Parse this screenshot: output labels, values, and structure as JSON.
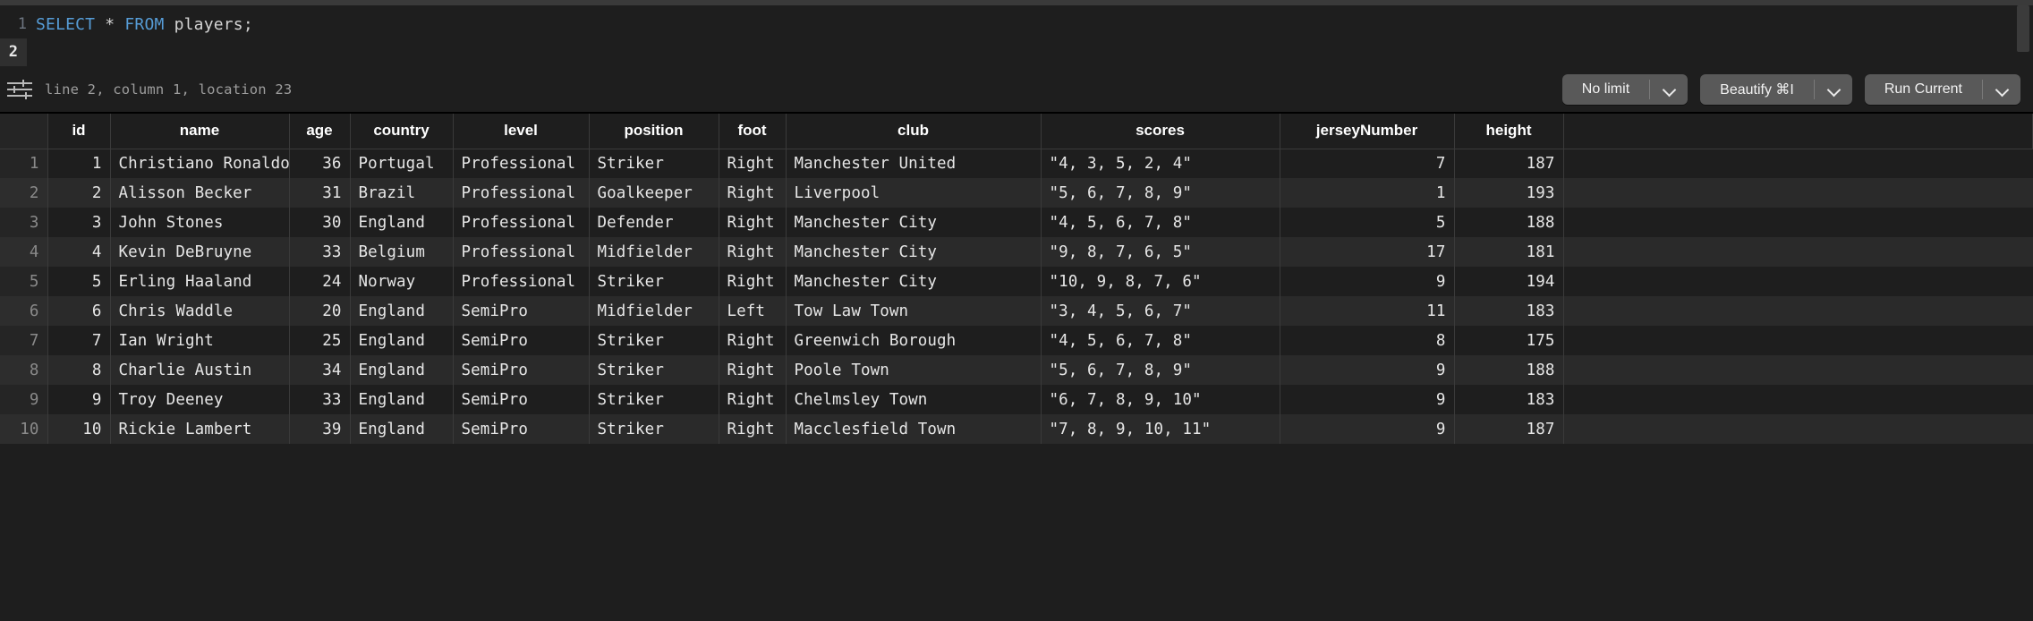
{
  "editor": {
    "line_numbers": [
      "1",
      "2"
    ],
    "active_line": "2",
    "code_tokens": [
      {
        "t": "SELECT",
        "k": "kw"
      },
      {
        "t": " ",
        "k": "op"
      },
      {
        "t": "*",
        "k": "op"
      },
      {
        "t": " ",
        "k": "op"
      },
      {
        "t": "FROM",
        "k": "kw"
      },
      {
        "t": " ",
        "k": "op"
      },
      {
        "t": "players;",
        "k": "id"
      }
    ],
    "code_text": "SELECT * FROM players;"
  },
  "statusbar": {
    "icon": "sliders-icon",
    "position_text": "line 2, column 1, location 23",
    "buttons": [
      {
        "label": "No limit",
        "icon": "chevron-down-icon"
      },
      {
        "label": "Beautify ⌘I",
        "icon": "chevron-down-icon"
      },
      {
        "label": "Run Current",
        "icon": "chevron-down-icon"
      }
    ]
  },
  "results": {
    "rownum_header": "",
    "columns": [
      {
        "key": "id",
        "label": "id",
        "align": "num"
      },
      {
        "key": "name",
        "label": "name",
        "align": "txt"
      },
      {
        "key": "age",
        "label": "age",
        "align": "num"
      },
      {
        "key": "country",
        "label": "country",
        "align": "txt"
      },
      {
        "key": "level",
        "label": "level",
        "align": "txt"
      },
      {
        "key": "position",
        "label": "position",
        "align": "txt"
      },
      {
        "key": "foot",
        "label": "foot",
        "align": "txt"
      },
      {
        "key": "club",
        "label": "club",
        "align": "txt"
      },
      {
        "key": "scores",
        "label": "scores",
        "align": "txt"
      },
      {
        "key": "jerseyNumber",
        "label": "jerseyNumber",
        "align": "num"
      },
      {
        "key": "height",
        "label": "height",
        "align": "num"
      }
    ],
    "rows": [
      {
        "n": "1",
        "id": "1",
        "name": "Christiano Ronaldo",
        "age": "36",
        "country": "Portugal",
        "level": "Professional",
        "position": "Striker",
        "foot": "Right",
        "club": "Manchester United",
        "scores": "\"4, 3, 5, 2, 4\"",
        "jerseyNumber": "7",
        "height": "187"
      },
      {
        "n": "2",
        "id": "2",
        "name": "Alisson Becker",
        "age": "31",
        "country": "Brazil",
        "level": "Professional",
        "position": "Goalkeeper",
        "foot": "Right",
        "club": "Liverpool",
        "scores": "\"5, 6, 7, 8, 9\"",
        "jerseyNumber": "1",
        "height": "193"
      },
      {
        "n": "3",
        "id": "3",
        "name": "John Stones",
        "age": "30",
        "country": "England",
        "level": "Professional",
        "position": "Defender",
        "foot": "Right",
        "club": "Manchester City",
        "scores": "\"4, 5, 6, 7, 8\"",
        "jerseyNumber": "5",
        "height": "188"
      },
      {
        "n": "4",
        "id": "4",
        "name": "Kevin DeBruyne",
        "age": "33",
        "country": "Belgium",
        "level": "Professional",
        "position": "Midfielder",
        "foot": "Right",
        "club": "Manchester City",
        "scores": "\"9, 8, 7, 6, 5\"",
        "jerseyNumber": "17",
        "height": "181"
      },
      {
        "n": "5",
        "id": "5",
        "name": "Erling Haaland",
        "age": "24",
        "country": "Norway",
        "level": "Professional",
        "position": "Striker",
        "foot": "Right",
        "club": "Manchester City",
        "scores": "\"10, 9, 8, 7, 6\"",
        "jerseyNumber": "9",
        "height": "194"
      },
      {
        "n": "6",
        "id": "6",
        "name": "Chris Waddle",
        "age": "20",
        "country": "England",
        "level": "SemiPro",
        "position": "Midfielder",
        "foot": "Left",
        "club": "Tow Law Town",
        "scores": "\"3, 4, 5, 6, 7\"",
        "jerseyNumber": "11",
        "height": "183"
      },
      {
        "n": "7",
        "id": "7",
        "name": "Ian Wright",
        "age": "25",
        "country": "England",
        "level": "SemiPro",
        "position": "Striker",
        "foot": "Right",
        "club": "Greenwich Borough",
        "scores": "\"4, 5, 6, 7, 8\"",
        "jerseyNumber": "8",
        "height": "175"
      },
      {
        "n": "8",
        "id": "8",
        "name": "Charlie Austin",
        "age": "34",
        "country": "England",
        "level": "SemiPro",
        "position": "Striker",
        "foot": "Right",
        "club": "Poole Town",
        "scores": "\"5, 6, 7, 8, 9\"",
        "jerseyNumber": "9",
        "height": "188"
      },
      {
        "n": "9",
        "id": "9",
        "name": "Troy Deeney",
        "age": "33",
        "country": "England",
        "level": "SemiPro",
        "position": "Striker",
        "foot": "Right",
        "club": "Chelmsley Town",
        "scores": "\"6, 7, 8, 9, 10\"",
        "jerseyNumber": "9",
        "height": "183"
      },
      {
        "n": "10",
        "id": "10",
        "name": "Rickie Lambert",
        "age": "39",
        "country": "England",
        "level": "SemiPro",
        "position": "Striker",
        "foot": "Right",
        "club": "Macclesfield Town",
        "scores": "\"7, 8, 9, 10, 11\"",
        "jerseyNumber": "9",
        "height": "187"
      }
    ]
  },
  "colors": {
    "background": "#1e1e1e",
    "row_alt": "#2a2a2a",
    "keyword": "#569cd6",
    "text": "#d4d4d4",
    "muted": "#9d9d9d",
    "button": "#595959",
    "divider": "#3a3a3a"
  }
}
